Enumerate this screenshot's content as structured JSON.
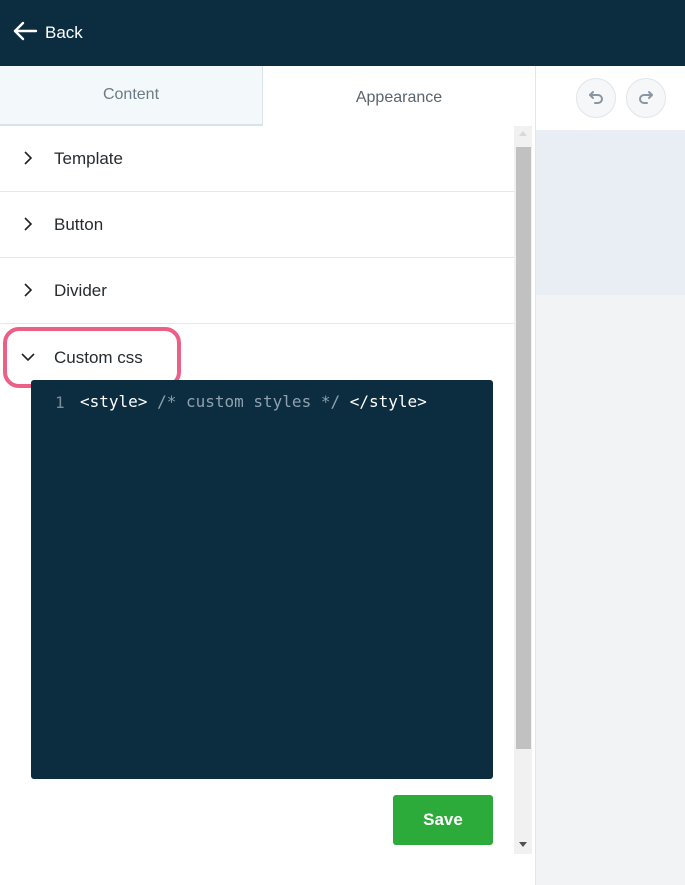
{
  "header": {
    "back_label": "Back"
  },
  "tabs": [
    {
      "label": "Content",
      "active": false
    },
    {
      "label": "Appearance",
      "active": true
    }
  ],
  "sections": [
    {
      "label": "Template",
      "expanded": false
    },
    {
      "label": "Button",
      "expanded": false
    },
    {
      "label": "Divider",
      "expanded": false
    },
    {
      "label": "Custom css",
      "expanded": true
    }
  ],
  "editor": {
    "line_number": "1",
    "open_tag": "<style>",
    "comment": " /* custom styles */ ",
    "close_tag": "</style>"
  },
  "save_label": "Save",
  "icons": {
    "back": "arrow-left-icon",
    "collapsed": "chevron-right-icon",
    "expanded": "chevron-down-icon",
    "undo": "undo-icon",
    "redo": "redo-icon"
  },
  "colors": {
    "header_bg": "#0c2d40",
    "editor_bg": "#0c2d40",
    "save_button": "#2caa3a",
    "highlight": "#ec5f86"
  }
}
